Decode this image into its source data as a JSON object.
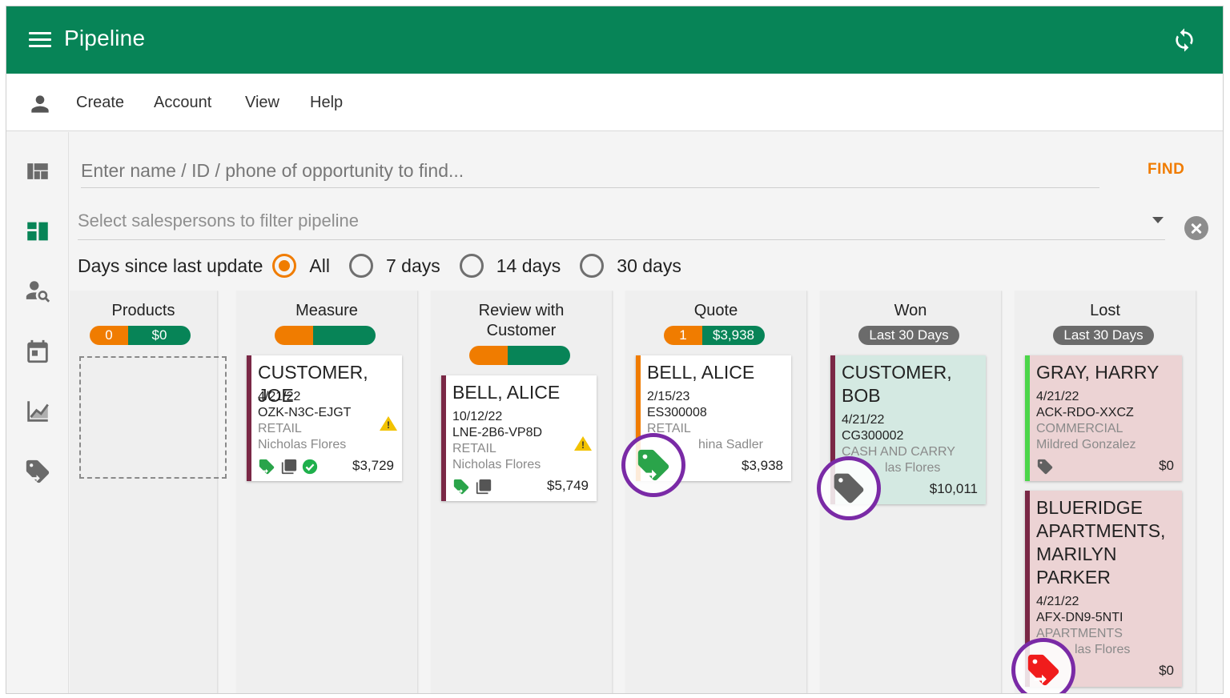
{
  "app": {
    "title": "Pipeline"
  },
  "menu": {
    "items": [
      "Create",
      "Account",
      "View",
      "Help"
    ]
  },
  "sidenav": {
    "icons": [
      "dashboard-icon",
      "pipeline-board-icon",
      "person-search-icon",
      "calendar-icon",
      "chart-icon",
      "tag-return-icon"
    ]
  },
  "search": {
    "placeholder": "Enter name / ID / phone of opportunity to find...",
    "find_label": "FIND"
  },
  "salesperson_filter": {
    "placeholder": "Select salespersons to filter pipeline"
  },
  "days_filter": {
    "label": "Days since last update",
    "options": [
      "All",
      "7 days",
      "14 days",
      "30 days"
    ],
    "selected": "All"
  },
  "colors": {
    "primary": "#078457",
    "accent": "#f07c00",
    "won_card": "#d4e9e2",
    "lost_card": "#ecd3d4",
    "card_border": "#7a2846"
  },
  "columns": [
    {
      "title": "Products",
      "count": "0",
      "total": "$0",
      "cards": []
    },
    {
      "title": "Measure",
      "count": "",
      "total": "",
      "cards": [
        {
          "name": "CUSTOMER, JOE",
          "date": "4/21/22",
          "id": "OZK-N3C-EJGT",
          "type": "RETAIL",
          "rep": "Nicholas Flores",
          "amount": "$3,729",
          "warning": true
        }
      ]
    },
    {
      "title": "Review with Customer",
      "count": "",
      "total": "",
      "cards": [
        {
          "name": "BELL, ALICE",
          "date": "10/12/22",
          "id": "LNE-2B6-VP8D",
          "type": "RETAIL",
          "rep": "Nicholas Flores",
          "amount": "$5,749",
          "warning": true
        }
      ]
    },
    {
      "title": "Quote",
      "count": "1",
      "total": "$3,938",
      "cards": [
        {
          "name": "BELL, ALICE",
          "date": "2/15/23",
          "id": "ES300008",
          "type": "RETAIL",
          "rep": "hina Sadler",
          "amount": "$3,938"
        }
      ]
    },
    {
      "title": "Won",
      "badge": "Last 30 Days",
      "cards": [
        {
          "name_line1": "CUSTOMER,",
          "name_line2": "BOB",
          "date": "4/21/22",
          "id": "CG300002",
          "type": "CASH AND CARRY",
          "rep": "las Flores",
          "amount": "$10,011"
        }
      ]
    },
    {
      "title": "Lost",
      "badge": "Last 30 Days",
      "cards": [
        {
          "name": "GRAY, HARRY",
          "date": "4/21/22",
          "id": "ACK-RDO-XXCZ",
          "type": "COMMERCIAL",
          "rep": "Mildred Gonzalez",
          "amount": "$0"
        },
        {
          "name_lines": [
            "BLUERIDGE",
            "APARTMENTS,",
            "MARILYN",
            "PARKER"
          ],
          "date": "4/21/22",
          "id": "AFX-DN9-5NTI",
          "type": "APARTMENTS",
          "rep": "las Flores",
          "amount": "$0"
        }
      ]
    }
  ]
}
